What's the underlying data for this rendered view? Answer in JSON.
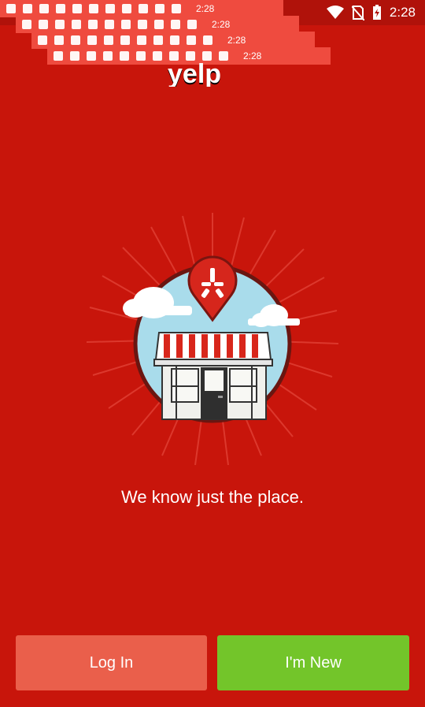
{
  "status_bar": {
    "time": "2:28",
    "icons": [
      "wifi-icon",
      "no-sim-icon",
      "battery-charging-icon"
    ],
    "glitch_time": "2:28"
  },
  "app": {
    "logo_text": "yelp",
    "tagline": "We know just the place."
  },
  "buttons": {
    "login_label": "Log In",
    "new_label": "I'm New"
  },
  "colors": {
    "background": "#c8150b",
    "login": "#ea5f4b",
    "new": "#73c52a"
  }
}
